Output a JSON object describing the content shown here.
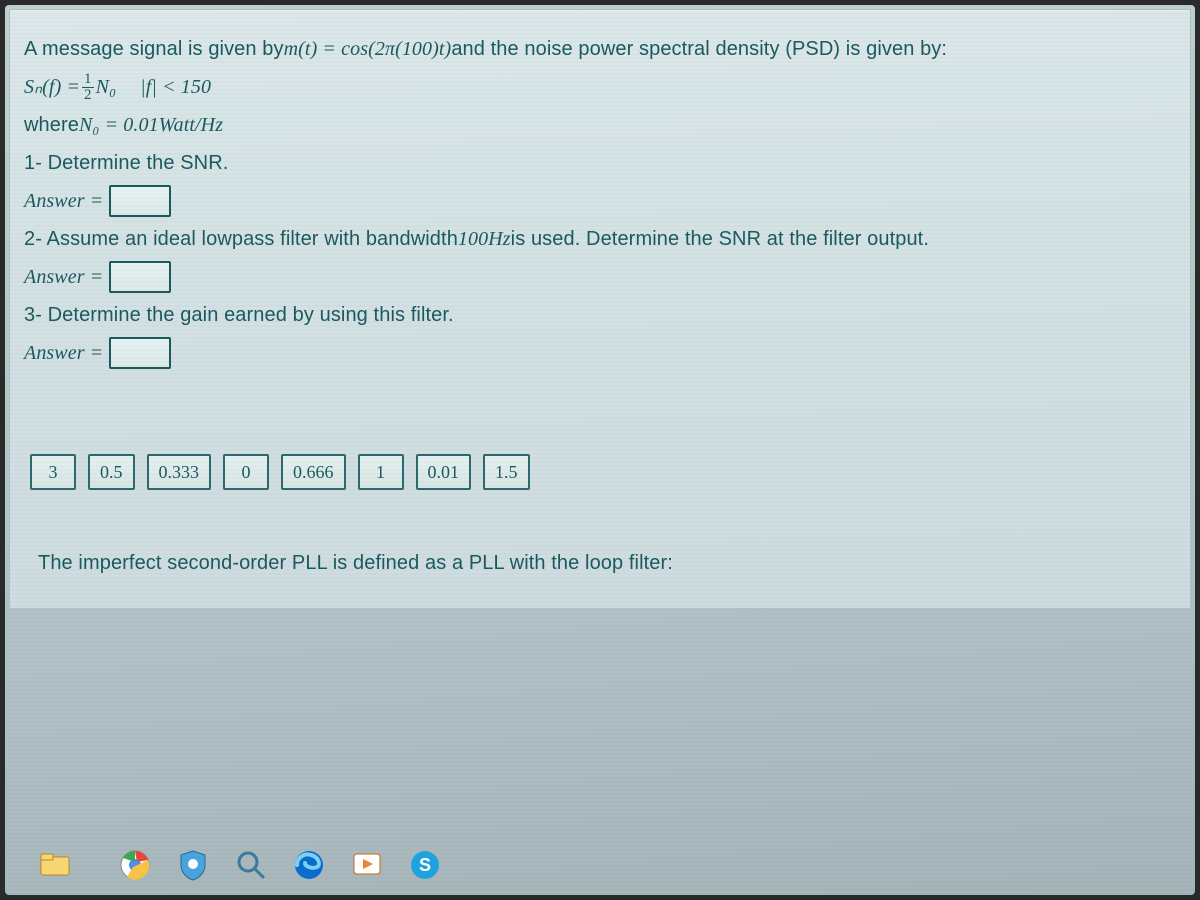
{
  "problem": {
    "intro_prefix": "A message signal is given by ",
    "intro_eq": "m(t) = cos(2π(100)t)",
    "intro_suffix": "  and the noise power spectral density (PSD) is given by:",
    "psd_lhs": "Sₙ(f) = ",
    "psd_frac_num": "1",
    "psd_frac_den": "2",
    "psd_rhs": "N₀",
    "psd_cond": "|f| < 150",
    "where_prefix": "where ",
    "where_eq": "N₀ = 0.01Watt/Hz",
    "q1": "1- Determine the SNR.",
    "q2_prefix": "2- Assume an ideal lowpass filter with bandwidth ",
    "q2_bw": "100Hz",
    "q2_suffix": " is used. Determine the SNR at the filter output.",
    "q3": "3- Determine the gain earned by using this filter.",
    "answer_label": "Answer ="
  },
  "options": [
    "3",
    "0.5",
    "0.333",
    "0",
    "0.666",
    "1",
    "0.01",
    "1.5"
  ],
  "next_question": "The imperfect second-order PLL is defined as a PLL with the loop filter:",
  "taskbar_icons": [
    "file-explorer-icon",
    "chrome-icon",
    "security-shield-icon",
    "magnifier-icon",
    "edge-icon",
    "media-player-icon",
    "skype-icon"
  ]
}
